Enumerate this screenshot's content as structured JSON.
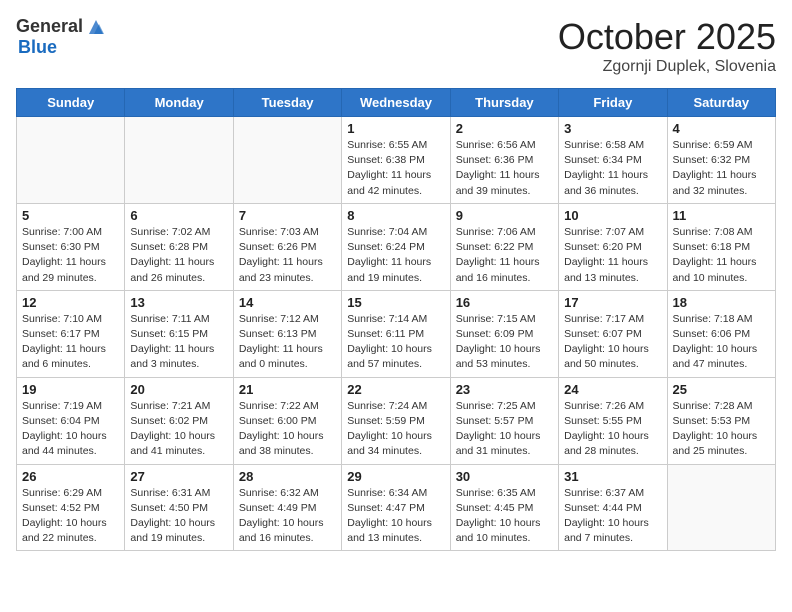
{
  "header": {
    "logo_general": "General",
    "logo_blue": "Blue",
    "month_title": "October 2025",
    "location": "Zgornji Duplek, Slovenia"
  },
  "weekdays": [
    "Sunday",
    "Monday",
    "Tuesday",
    "Wednesday",
    "Thursday",
    "Friday",
    "Saturday"
  ],
  "weeks": [
    [
      {
        "day": "",
        "info": ""
      },
      {
        "day": "",
        "info": ""
      },
      {
        "day": "",
        "info": ""
      },
      {
        "day": "1",
        "info": "Sunrise: 6:55 AM\nSunset: 6:38 PM\nDaylight: 11 hours and 42 minutes."
      },
      {
        "day": "2",
        "info": "Sunrise: 6:56 AM\nSunset: 6:36 PM\nDaylight: 11 hours and 39 minutes."
      },
      {
        "day": "3",
        "info": "Sunrise: 6:58 AM\nSunset: 6:34 PM\nDaylight: 11 hours and 36 minutes."
      },
      {
        "day": "4",
        "info": "Sunrise: 6:59 AM\nSunset: 6:32 PM\nDaylight: 11 hours and 32 minutes."
      }
    ],
    [
      {
        "day": "5",
        "info": "Sunrise: 7:00 AM\nSunset: 6:30 PM\nDaylight: 11 hours and 29 minutes."
      },
      {
        "day": "6",
        "info": "Sunrise: 7:02 AM\nSunset: 6:28 PM\nDaylight: 11 hours and 26 minutes."
      },
      {
        "day": "7",
        "info": "Sunrise: 7:03 AM\nSunset: 6:26 PM\nDaylight: 11 hours and 23 minutes."
      },
      {
        "day": "8",
        "info": "Sunrise: 7:04 AM\nSunset: 6:24 PM\nDaylight: 11 hours and 19 minutes."
      },
      {
        "day": "9",
        "info": "Sunrise: 7:06 AM\nSunset: 6:22 PM\nDaylight: 11 hours and 16 minutes."
      },
      {
        "day": "10",
        "info": "Sunrise: 7:07 AM\nSunset: 6:20 PM\nDaylight: 11 hours and 13 minutes."
      },
      {
        "day": "11",
        "info": "Sunrise: 7:08 AM\nSunset: 6:18 PM\nDaylight: 11 hours and 10 minutes."
      }
    ],
    [
      {
        "day": "12",
        "info": "Sunrise: 7:10 AM\nSunset: 6:17 PM\nDaylight: 11 hours and 6 minutes."
      },
      {
        "day": "13",
        "info": "Sunrise: 7:11 AM\nSunset: 6:15 PM\nDaylight: 11 hours and 3 minutes."
      },
      {
        "day": "14",
        "info": "Sunrise: 7:12 AM\nSunset: 6:13 PM\nDaylight: 11 hours and 0 minutes."
      },
      {
        "day": "15",
        "info": "Sunrise: 7:14 AM\nSunset: 6:11 PM\nDaylight: 10 hours and 57 minutes."
      },
      {
        "day": "16",
        "info": "Sunrise: 7:15 AM\nSunset: 6:09 PM\nDaylight: 10 hours and 53 minutes."
      },
      {
        "day": "17",
        "info": "Sunrise: 7:17 AM\nSunset: 6:07 PM\nDaylight: 10 hours and 50 minutes."
      },
      {
        "day": "18",
        "info": "Sunrise: 7:18 AM\nSunset: 6:06 PM\nDaylight: 10 hours and 47 minutes."
      }
    ],
    [
      {
        "day": "19",
        "info": "Sunrise: 7:19 AM\nSunset: 6:04 PM\nDaylight: 10 hours and 44 minutes."
      },
      {
        "day": "20",
        "info": "Sunrise: 7:21 AM\nSunset: 6:02 PM\nDaylight: 10 hours and 41 minutes."
      },
      {
        "day": "21",
        "info": "Sunrise: 7:22 AM\nSunset: 6:00 PM\nDaylight: 10 hours and 38 minutes."
      },
      {
        "day": "22",
        "info": "Sunrise: 7:24 AM\nSunset: 5:59 PM\nDaylight: 10 hours and 34 minutes."
      },
      {
        "day": "23",
        "info": "Sunrise: 7:25 AM\nSunset: 5:57 PM\nDaylight: 10 hours and 31 minutes."
      },
      {
        "day": "24",
        "info": "Sunrise: 7:26 AM\nSunset: 5:55 PM\nDaylight: 10 hours and 28 minutes."
      },
      {
        "day": "25",
        "info": "Sunrise: 7:28 AM\nSunset: 5:53 PM\nDaylight: 10 hours and 25 minutes."
      }
    ],
    [
      {
        "day": "26",
        "info": "Sunrise: 6:29 AM\nSunset: 4:52 PM\nDaylight: 10 hours and 22 minutes."
      },
      {
        "day": "27",
        "info": "Sunrise: 6:31 AM\nSunset: 4:50 PM\nDaylight: 10 hours and 19 minutes."
      },
      {
        "day": "28",
        "info": "Sunrise: 6:32 AM\nSunset: 4:49 PM\nDaylight: 10 hours and 16 minutes."
      },
      {
        "day": "29",
        "info": "Sunrise: 6:34 AM\nSunset: 4:47 PM\nDaylight: 10 hours and 13 minutes."
      },
      {
        "day": "30",
        "info": "Sunrise: 6:35 AM\nSunset: 4:45 PM\nDaylight: 10 hours and 10 minutes."
      },
      {
        "day": "31",
        "info": "Sunrise: 6:37 AM\nSunset: 4:44 PM\nDaylight: 10 hours and 7 minutes."
      },
      {
        "day": "",
        "info": ""
      }
    ]
  ]
}
